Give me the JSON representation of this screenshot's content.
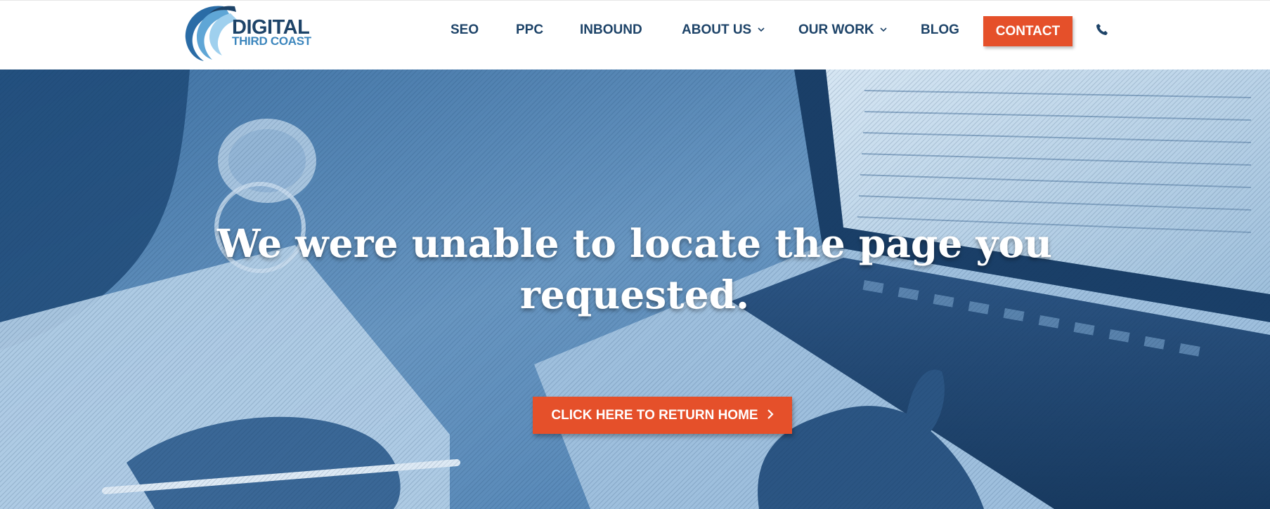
{
  "brand": {
    "logo_line1": "DIGITAL",
    "logo_line2": "THIRD COAST"
  },
  "nav": {
    "items": [
      {
        "label": "SEO"
      },
      {
        "label": "PPC"
      },
      {
        "label": "INBOUND"
      },
      {
        "label": "ABOUT US",
        "icon": "chevron-down-icon"
      },
      {
        "label": "OUR WORK",
        "icon": "chevron-down-icon"
      },
      {
        "label": "BLOG"
      }
    ],
    "contact_label": "CONTACT",
    "phone_icon": "phone-icon"
  },
  "hero": {
    "title": "We were unable to locate the page you requested.",
    "button_label": "CLICK HERE TO RETURN HOME",
    "button_icon": "chevron-right-icon"
  },
  "colors": {
    "navy": "#1d4368",
    "accent_blue": "#3c86bd",
    "accent_orange": "#e5502a",
    "hero_blue": "#5d8cb8"
  }
}
